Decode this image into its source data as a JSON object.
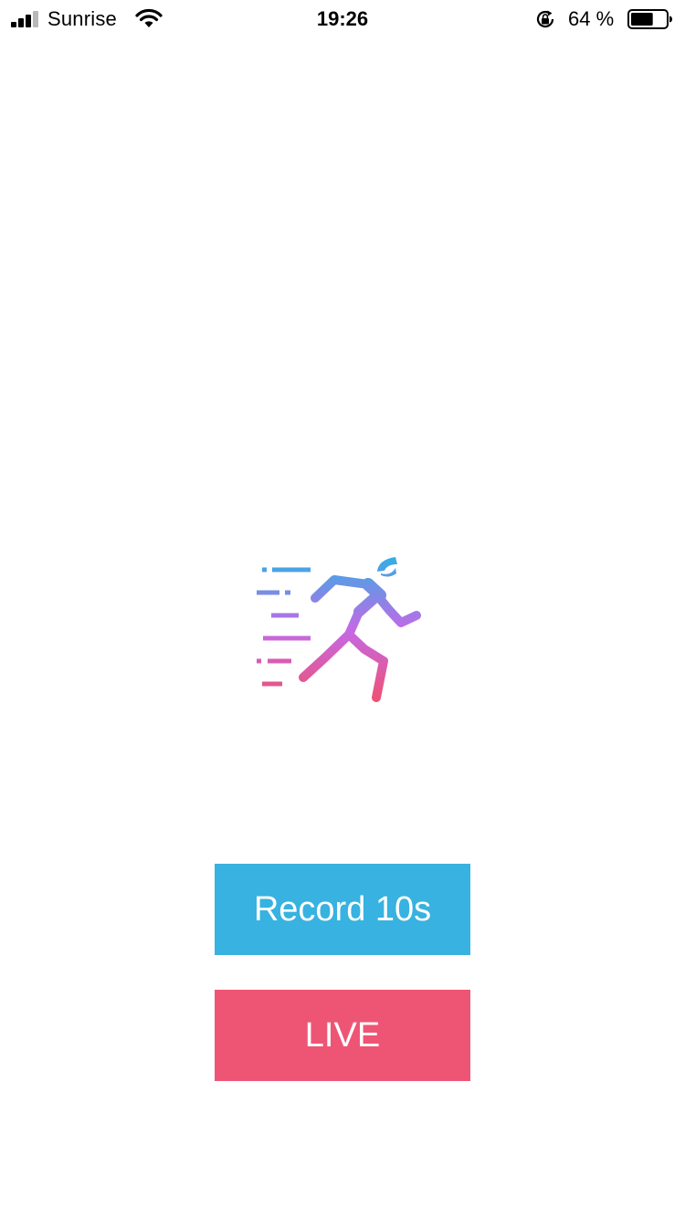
{
  "status_bar": {
    "carrier": "Sunrise",
    "time": "19:26",
    "battery_percent_label": "64 %",
    "battery_level": 0.64,
    "signal_bars": 3,
    "signal_bars_total": 4,
    "icons": [
      "signal-icon",
      "wifi-icon",
      "rotation-lock-icon",
      "battery-icon"
    ]
  },
  "logo": {
    "icon": "running-man-icon",
    "gradient": [
      "#33aee4",
      "#c469e6",
      "#f0506f"
    ]
  },
  "buttons": {
    "record": {
      "label": "Record 10s",
      "color": "#38b2e0"
    },
    "live": {
      "label": "LIVE",
      "color": "#ee5575"
    }
  }
}
